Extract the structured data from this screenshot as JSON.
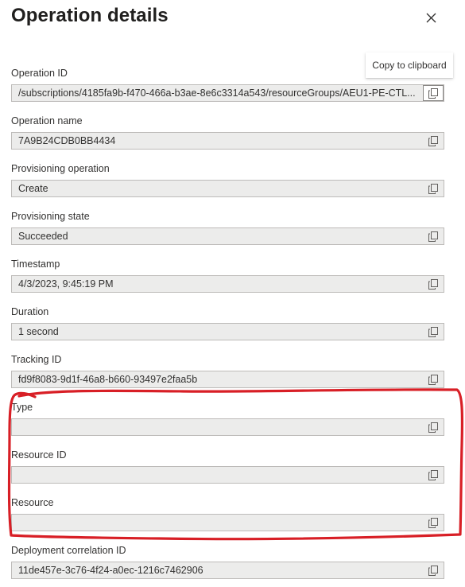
{
  "panel": {
    "title": "Operation details",
    "tooltip": "Copy to clipboard"
  },
  "fields": [
    {
      "label": "Operation ID",
      "value": "/subscriptions/4185fa9b-f470-466a-b3ae-8e6c3314a543/resourceGroups/AEU1-PE-CTL..."
    },
    {
      "label": "Operation name",
      "value": "7A9B24CDB0BB4434"
    },
    {
      "label": "Provisioning operation",
      "value": "Create"
    },
    {
      "label": "Provisioning state",
      "value": "Succeeded"
    },
    {
      "label": "Timestamp",
      "value": "4/3/2023, 9:45:19 PM"
    },
    {
      "label": "Duration",
      "value": "1 second"
    },
    {
      "label": "Tracking ID",
      "value": "fd9f8083-9d1f-46a8-b660-93497e2faa5b"
    },
    {
      "label": "Type",
      "value": ""
    },
    {
      "label": "Resource ID",
      "value": ""
    },
    {
      "label": "Resource",
      "value": ""
    },
    {
      "label": "Deployment correlation ID",
      "value": "11de457e-3c76-4f24-a0ec-1216c7462906"
    }
  ],
  "icons": {
    "close": "close-icon",
    "copy": "copy-icon"
  },
  "colors": {
    "annotation": "#d81f26",
    "field_background": "#ececeb",
    "field_border": "#bdbbb9"
  }
}
